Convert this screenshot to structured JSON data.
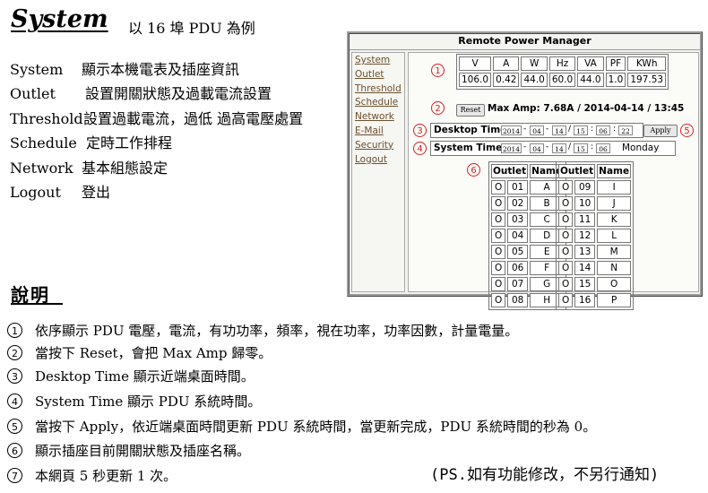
{
  "header": {
    "title": "System",
    "subtitle": "以 16 埠  PDU 為例"
  },
  "menu_items": [
    {
      "term": "System",
      "desc": "顯示本機電表及插座資訊"
    },
    {
      "term": "Outlet",
      "desc": "設置開關狀態及過載電流設置"
    },
    {
      "term": "Threshold",
      "desc": "設置過載電流，過低  過高電壓處置"
    },
    {
      "term": "Schedule",
      "desc": "定時工作排程"
    },
    {
      "term": "Network",
      "desc": "基本組態設定"
    },
    {
      "term": "Logout",
      "desc": "登出"
    }
  ],
  "panel": {
    "title": "Remote Power Manager",
    "nav": [
      "System",
      "Outlet",
      "Threshold",
      "Schedule",
      "Network",
      "E-Mail",
      "Security",
      "Logout"
    ],
    "callouts": [
      "1",
      "2",
      "3",
      "4",
      "5",
      "6"
    ],
    "meter": {
      "headers": [
        "V",
        "A",
        "W",
        "Hz",
        "VA",
        "PF",
        "KWh"
      ],
      "values": [
        "106.0",
        "0.42",
        "44.0",
        "60.0",
        "44.0",
        "1.0",
        "197.53"
      ]
    },
    "reset_label": "Reset",
    "max_amp_text": "Max Amp: 7.68A / 2014-04-14 / 13:45",
    "desktop_time": {
      "label": "Desktop Time",
      "year": "2014",
      "month": "04",
      "day": "14",
      "hour": "15",
      "minute": "06",
      "second": "22",
      "apply_label": "Apply"
    },
    "system_time": {
      "label": "System Time",
      "year": "2014",
      "month": "04",
      "day": "14",
      "hour": "15",
      "minute": "06",
      "weekday": "Monday"
    },
    "outlets": {
      "headers": [
        "Outlet",
        "Name"
      ],
      "left": [
        {
          "state": "O",
          "num": "01",
          "name": "A"
        },
        {
          "state": "O",
          "num": "02",
          "name": "B"
        },
        {
          "state": "O",
          "num": "03",
          "name": "C"
        },
        {
          "state": "O",
          "num": "04",
          "name": "D"
        },
        {
          "state": "O",
          "num": "05",
          "name": "E"
        },
        {
          "state": "O",
          "num": "06",
          "name": "F"
        },
        {
          "state": "O",
          "num": "07",
          "name": "G"
        },
        {
          "state": "O",
          "num": "08",
          "name": "H"
        }
      ],
      "right": [
        {
          "state": "O",
          "num": "09",
          "name": "I"
        },
        {
          "state": "O",
          "num": "10",
          "name": "J"
        },
        {
          "state": "O",
          "num": "11",
          "name": "K"
        },
        {
          "state": "O",
          "num": "12",
          "name": "L"
        },
        {
          "state": "O",
          "num": "13",
          "name": "M"
        },
        {
          "state": "O",
          "num": "14",
          "name": "N"
        },
        {
          "state": "O",
          "num": "15",
          "name": "O"
        },
        {
          "state": "O",
          "num": "16",
          "name": "P"
        }
      ]
    }
  },
  "explanation": {
    "heading": "說明",
    "items": [
      {
        "num": "1",
        "text": "依序顯示 PDU 電壓，電流，有功功率，頻率，視在功率，功率因數，計量電量。"
      },
      {
        "num": "2",
        "text": "當按下 Reset，會把 Max Amp 歸零。"
      },
      {
        "num": "3",
        "text": "Desktop Time 顯示近端桌面時間。"
      },
      {
        "num": "4",
        "text": "System Time 顯示 PDU 系統時間。"
      },
      {
        "num": "5",
        "text": "當按下 Apply，依近端桌面時間更新 PDU 系統時間，當更新完成，PDU 系統時間的秒為 0。"
      },
      {
        "num": "6",
        "text": "顯示插座目前開關狀態及插座名稱。"
      },
      {
        "num": "7",
        "text": "本網頁 5 秒更新 1 次。"
      }
    ],
    "ps_note": "(PS.如有功能修改，不另行通知)"
  },
  "colors": {
    "callout": "#d42020",
    "nav_link": "#6b5030",
    "panel_bg": "#f4f4f0"
  }
}
